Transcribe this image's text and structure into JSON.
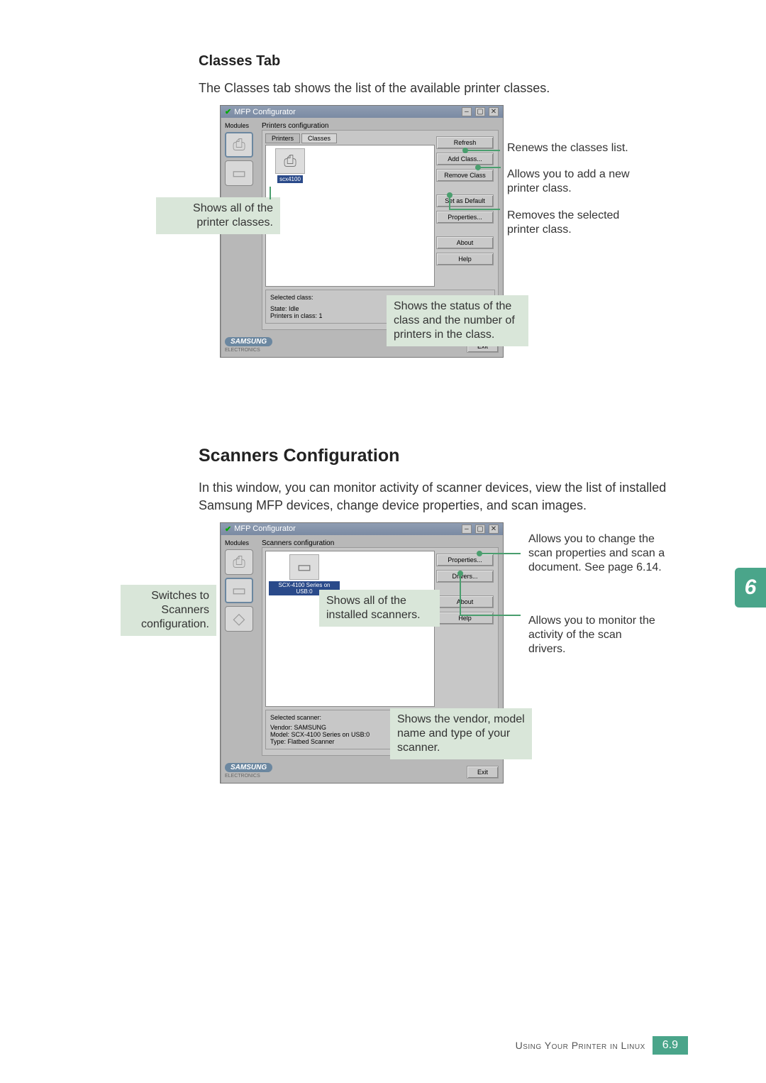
{
  "section1": {
    "heading": "Classes Tab",
    "intro": "The Classes tab shows the list of the available printer classes."
  },
  "win1": {
    "title": "MFP Configurator",
    "modules_label": "Modules",
    "group_title": "Printers configuration",
    "tab_printers": "Printers",
    "tab_classes": "Classes",
    "item_label": "scx4100",
    "buttons": {
      "refresh": "Refresh",
      "add": "Add Class...",
      "remove": "Remove Class",
      "set": "Set as Default",
      "properties": "Properties...",
      "about": "About",
      "help": "Help"
    },
    "selinfo_title": "Selected class:",
    "selinfo_state": "State: Idle",
    "selinfo_count": "Printers in class: 1",
    "brand": "SAMSUNG",
    "brandsub": "ELECTRONICS",
    "exit": "Exit"
  },
  "callouts1": {
    "left": "Shows all of the printer classes.",
    "status": "Shows the status of the class and the number of printers in the class.",
    "refresh": "Renews the classes list.",
    "add": "Allows you to add a new printer class.",
    "remove": "Removes the selected printer class."
  },
  "section2": {
    "heading": "Scanners Configuration",
    "intro": "In this window, you can monitor activity of scanner devices, view the list of installed Samsung MFP devices, change device properties, and scan images."
  },
  "win2": {
    "title": "MFP Configurator",
    "modules_label": "Modules",
    "group_title": "Scanners configuration",
    "item_label": "SCX-4100 Series on USB:0",
    "buttons": {
      "props": "Properties...",
      "drivers": "Drivers...",
      "about": "About",
      "help": "Help"
    },
    "selinfo_title": "Selected scanner:",
    "selinfo_vendor": "Vendor: SAMSUNG",
    "selinfo_model": "Model: SCX-4100 Series on USB:0",
    "selinfo_type": "Type: Flatbed Scanner",
    "brand": "SAMSUNG",
    "brandsub": "ELECTRONICS",
    "exit": "Exit"
  },
  "callouts2": {
    "switch": "Switches to Scanners configuration.",
    "installed": "Shows all of the installed scanners.",
    "vendor": "Shows the vendor, model name and type of your scanner.",
    "props": "Allows you to change the scan properties and scan a document. See page 6.14.",
    "drivers": "Allows you to monitor the activity of the scan drivers."
  },
  "footer": {
    "text": "Using Your Printer in Linux",
    "page": "6.9"
  },
  "chapter": "6"
}
